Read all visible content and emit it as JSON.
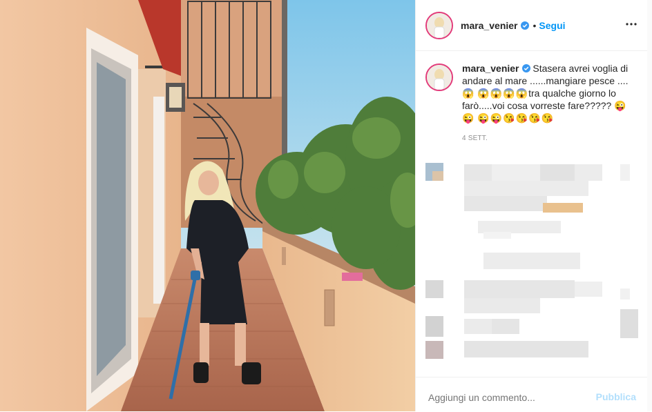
{
  "photo": {
    "alt_icon": "post-photo"
  },
  "header": {
    "username": "mara_venier",
    "separator": "•",
    "follow_label": "Segui",
    "more_icon": "more-horizontal-icon",
    "verified_icon": "verified-badge-icon"
  },
  "caption": {
    "username": "mara_venier",
    "text": "Stasera avrei voglia di andare al mare ......mangiare pesce ....",
    "emoji_1": "😱",
    "emoji_row_1": "😱😱😱😱",
    "text_2": "tra qualche giorno lo farò.....voi cosa vorreste fare?????",
    "emoji_row_2": "😜😜",
    "emoji_row_3": "😜😜😘😘😘😘",
    "time": "4 sett."
  },
  "footer": {
    "comment_placeholder": "Aggiungi un commento...",
    "publish_label": "Pubblica"
  },
  "colors": {
    "link": "#0095f6",
    "publish_disabled": "#b2dffc",
    "story_ring": "#e23a7a",
    "muted": "#8e8e8e"
  }
}
